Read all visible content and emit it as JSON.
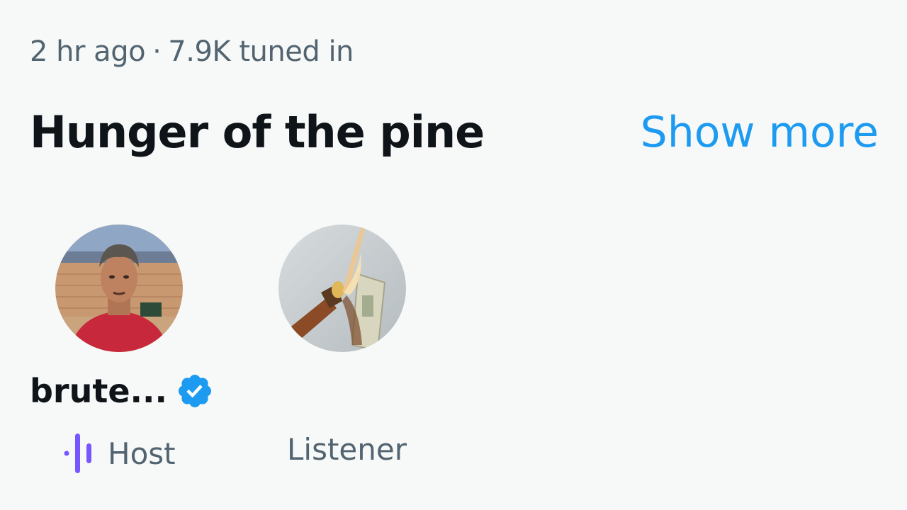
{
  "space": {
    "time_ago": "2 hr ago",
    "separator": "·",
    "tuned_in": "7.9K tuned in",
    "title": "Hunger of the pine",
    "show_more_label": "Show more"
  },
  "speakers": [
    {
      "name": "brute...",
      "verified": true,
      "role": "Host",
      "role_icon": "audio-bars-icon"
    },
    {
      "name": "",
      "verified": false,
      "role": "Listener"
    }
  ],
  "colors": {
    "accent": "#1d9bf0",
    "host_icon": "#7856ff",
    "text_primary": "#0f1419",
    "text_secondary": "#536471"
  }
}
